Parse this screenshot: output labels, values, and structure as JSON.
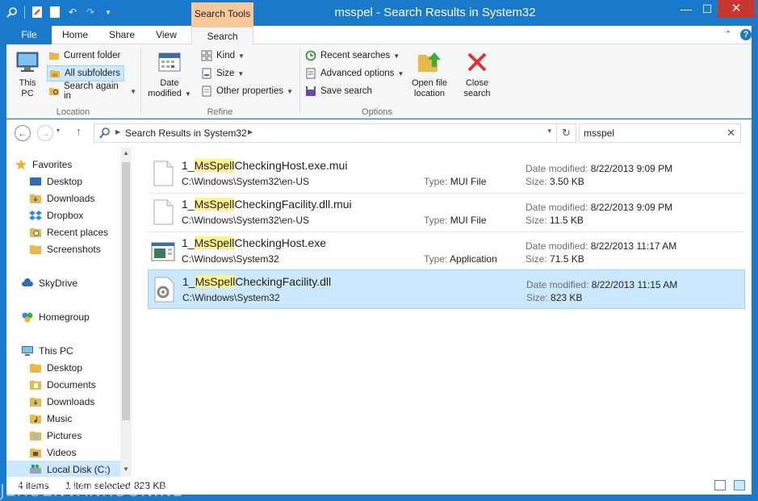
{
  "window": {
    "title": "msspel - Search Results in System32",
    "context_tab_header": "Search Tools",
    "controls": {
      "minimize": "—",
      "maximize": "☐",
      "close": "✕"
    }
  },
  "tabs": [
    {
      "label": "File"
    },
    {
      "label": "Home"
    },
    {
      "label": "Share"
    },
    {
      "label": "View"
    },
    {
      "label": "Search"
    }
  ],
  "ribbon": {
    "location": {
      "label": "Location",
      "this_pc": "This PC",
      "current_folder": "Current folder",
      "all_subfolders": "All subfolders",
      "search_again_in": "Search again in"
    },
    "refine": {
      "label": "Refine",
      "date_modified_1": "Date",
      "date_modified_2": "modified",
      "kind": "Kind",
      "size": "Size",
      "other_properties": "Other properties"
    },
    "options": {
      "label": "Options",
      "recent_searches": "Recent searches",
      "advanced_options": "Advanced options",
      "save_search": "Save search",
      "open_file_location_1": "Open file",
      "open_file_location_2": "location",
      "close_search_1": "Close",
      "close_search_2": "search"
    }
  },
  "address": {
    "breadcrumb": "Search Results in System32",
    "search_value": "msspel"
  },
  "nav": {
    "favorites": "Favorites",
    "fav_items": [
      "Desktop",
      "Downloads",
      "Dropbox",
      "Recent places",
      "Screenshots"
    ],
    "skydrive": "SkyDrive",
    "homegroup": "Homegroup",
    "this_pc": "This PC",
    "pc_items": [
      "Desktop",
      "Documents",
      "Downloads",
      "Music",
      "Pictures",
      "Videos",
      "Local Disk (C:)"
    ]
  },
  "results": [
    {
      "pre": "1_",
      "hl": "MsSpell",
      "post": "CheckingHost.exe.mui",
      "path": "C:\\Windows\\System32\\en-US",
      "type_label": "Type:",
      "type": "MUI File",
      "date_label": "Date modified:",
      "date": "8/22/2013 9:09 PM",
      "size_label": "Size:",
      "size": "3.50 KB"
    },
    {
      "pre": "1_",
      "hl": "MsSpell",
      "post": "CheckingFacility.dll.mui",
      "path": "C:\\Windows\\System32\\en-US",
      "type_label": "Type:",
      "type": "MUI File",
      "date_label": "Date modified:",
      "date": "8/22/2013 9:09 PM",
      "size_label": "Size:",
      "size": "11.5 KB"
    },
    {
      "pre": "1_",
      "hl": "MsSpell",
      "post": "CheckingHost.exe",
      "path": "C:\\Windows\\System32",
      "type_label": "Type:",
      "type": "Application",
      "date_label": "Date modified:",
      "date": "8/22/2013 11:17 AM",
      "size_label": "Size:",
      "size": "71.5 KB"
    },
    {
      "pre": "1_",
      "hl": "MsSpell",
      "post": "CheckingFacility.dll",
      "path": "C:\\Windows\\System32",
      "type_label": "",
      "type": "",
      "date_label": "Date modified:",
      "date": "8/22/2013 11:15 AM",
      "size_label": "Size:",
      "size": "823 KB"
    }
  ],
  "status": {
    "items": "4 items",
    "selected": "1 item selected",
    "sel_size": "823 KB"
  },
  "watermark": "JEROENVANROON.NL",
  "colors": {
    "accent": "#1979ca",
    "context": "#f6c89a",
    "selection": "#cce8ff",
    "highlight": "#fdf38a"
  }
}
